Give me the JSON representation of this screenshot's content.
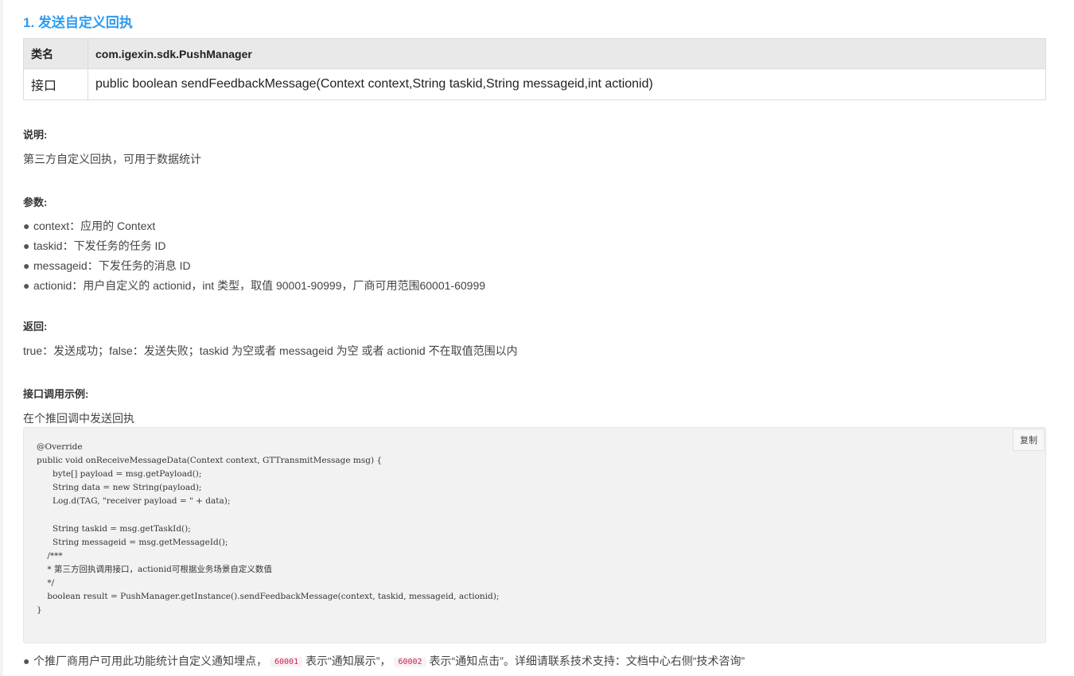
{
  "section": {
    "title": "1. 发送自定义回执"
  },
  "api_table": {
    "header": {
      "col1": "类名",
      "col2": "com.igexin.sdk.PushManager"
    },
    "row": {
      "col1": "接口",
      "col2": "public boolean sendFeedbackMessage(Context context,String taskid,String messageid,int actionid)"
    }
  },
  "description": {
    "label": "说明:",
    "text": "第三方自定义回执，可用于数据统计"
  },
  "params": {
    "label": "参数:",
    "bullet": "●",
    "items": [
      "context：应用的 Context",
      "taskid：下发任务的任务 ID",
      "messageid：下发任务的消息 ID",
      "actionid：用户自定义的 actionid，int 类型，取值 90001-90999，厂商可用范围60001-60999"
    ]
  },
  "returns": {
    "label": "返回:",
    "text": "true：发送成功；false：发送失败；taskid 为空或者 messageid 为空 或者 actionid 不在取值范围以内"
  },
  "example": {
    "label": "接口调用示例:",
    "intro": "在个推回调中发送回执",
    "copy_label": "复制",
    "code": "@Override\npublic void onReceiveMessageData(Context context, GTTransmitMessage msg) {\n      byte[] payload = msg.getPayload();\n      String data = new String(payload);\n      Log.d(TAG, \"receiver payload = \" + data);\n\n      String taskid = msg.getTaskId();\n      String messageid = msg.getMessageId();\n    /***\n    * 第三方回执调用接口，actionid可根据业务场景自定义数值\n    */\n    boolean result = PushManager.getInstance().sendFeedbackMessage(context, taskid, messageid, actionid);\n}"
  },
  "footer": {
    "bullet": "●",
    "text_before": "个推厂商用户可用此功能统计自定义通知埋点，",
    "code1": "60001",
    "text_middle": "表示“通知展示”，",
    "code2": "60002",
    "text_after": "表示“通知点击”。详细请联系技术支持：文档中心右侧“技术咨询”"
  }
}
